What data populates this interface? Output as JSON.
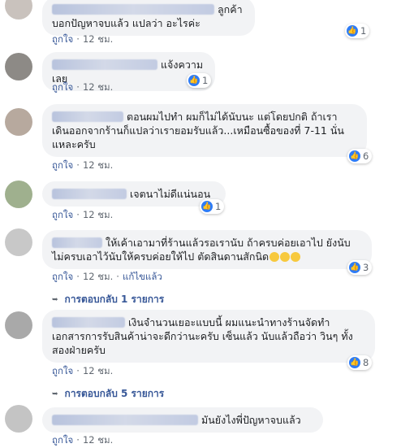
{
  "comments": [
    {
      "text": "ลูกค้าบอกปัญหาจบแล้ว แปลว่า อะไรค่ะ",
      "action": "ถูกใจ",
      "time": "12 ชม.",
      "likes": "1"
    },
    {
      "text": "แจ้งความเลย",
      "action": "ถูกใจ",
      "time": "12 ชม.",
      "likes": "1"
    },
    {
      "text": "ตอนผมไปทำ ผมก็ไม่ได้นับนะ แต่โดยปกติ ถ้าเรา เดินออกจากร้านก็แปลว่าเรายอมรับแล้ว...เหมือนซื้อของที่ 7-11 นั่นแหละครับ",
      "action": "ถูกใจ",
      "time": "12 ชม.",
      "likes": "6"
    },
    {
      "text": "เจตนาไม่ดีแน่นอน",
      "action": "ถูกใจ",
      "time": "12 ชม.",
      "likes": "1"
    },
    {
      "text": "ให้เค้าเอามาที่ร้านแล้วรอเรานับ ถ้าครบค่อยเอาไป ยังนับไม่ครบเอาไว้นับให้ครบค่อยให้ไป ตัดสินดานสักนิด",
      "action": "ถูกใจ",
      "time": "12 ชม.",
      "edited": "แก้ไขแล้ว",
      "likes": "3",
      "replies": "การตอบกลับ 1 รายการ"
    },
    {
      "text": "เงินจำนวนเยอะแบบนี้ ผมแนะนำทางร้านจัดทำ เอกสารการรับสินค้าน่าจะดีกว่านะครับ เซ็นแล้ว นับแล้วถือว่า วินๆ ทั้งสองฝ่ายครับ",
      "action": "ถูกใจ",
      "time": "12 ชม.",
      "likes": "8",
      "replies": "การตอบกลับ 5 รายการ"
    },
    {
      "text": "มันยังไงพี่ปัญหาจบแล้ว",
      "action": "ถูกใจ",
      "time": "12 ชม."
    }
  ]
}
